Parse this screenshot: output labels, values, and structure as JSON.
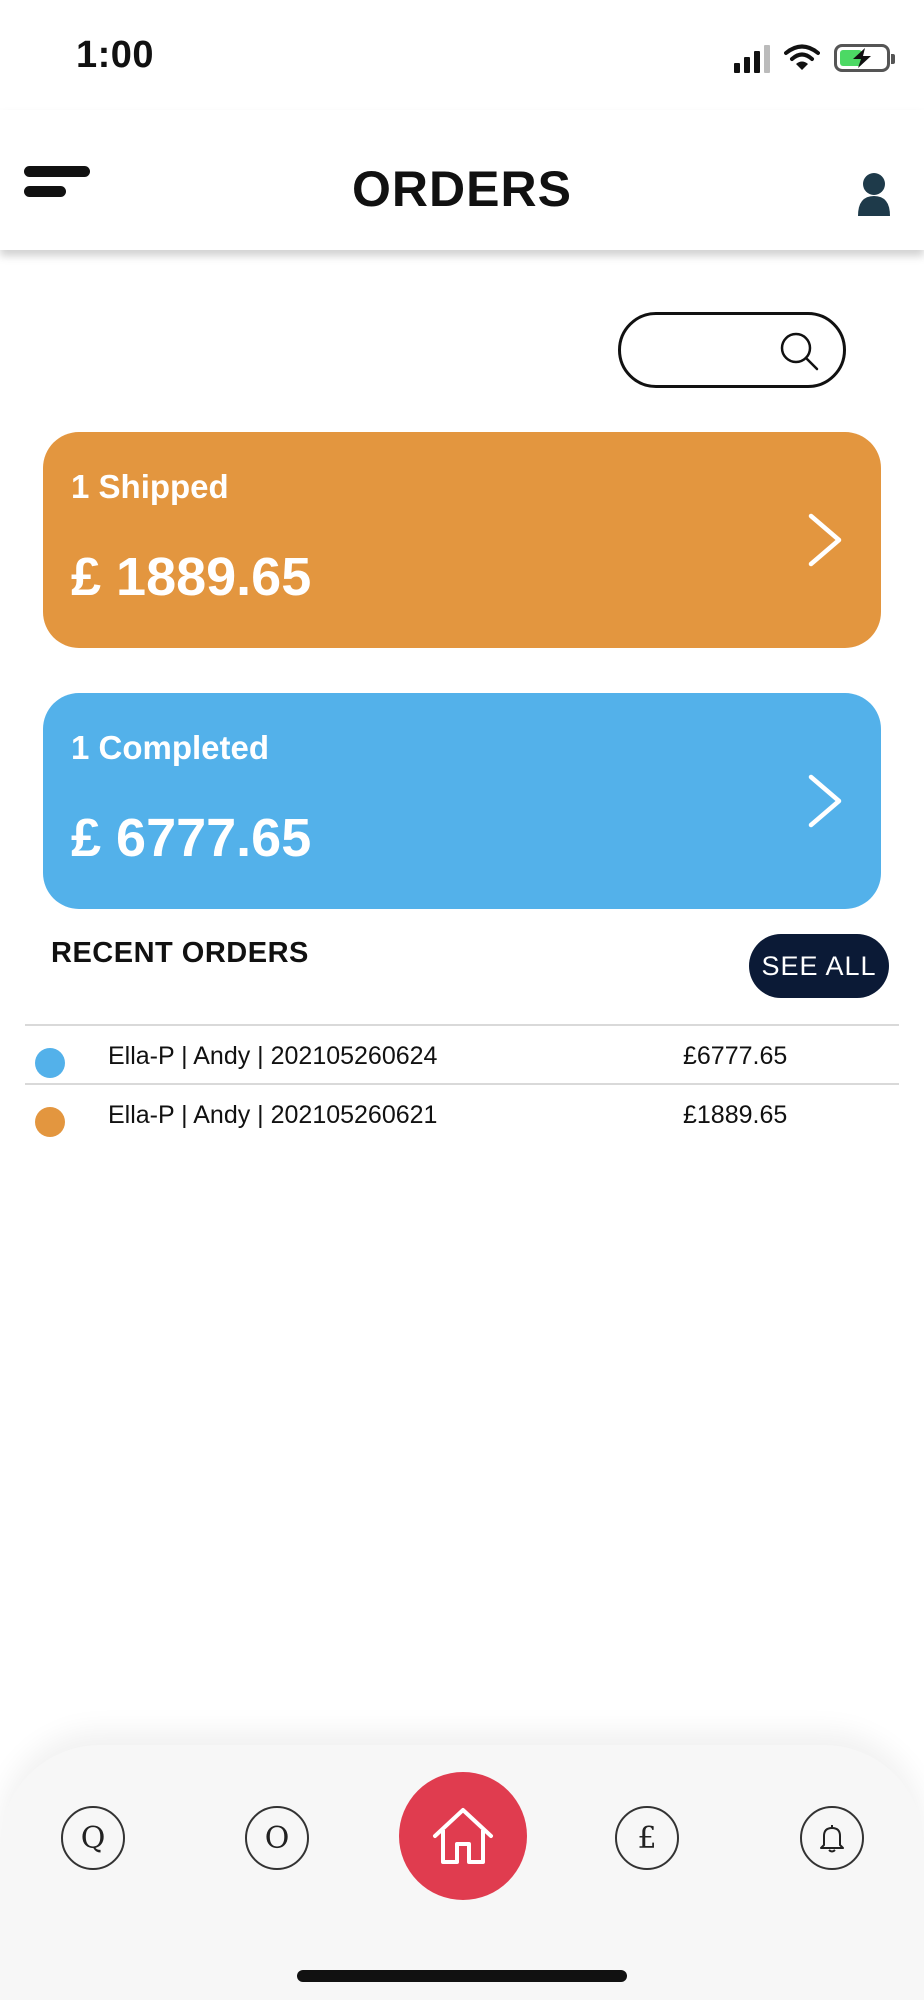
{
  "status_bar": {
    "time": "1:00",
    "icons": [
      "signal-icon",
      "wifi-icon",
      "battery-charging-icon"
    ]
  },
  "header": {
    "title": "ORDERS",
    "menu_icon": "menu-icon",
    "profile_icon": "user-icon"
  },
  "search": {
    "placeholder": "",
    "value": "",
    "icon": "search-icon"
  },
  "cards": [
    {
      "label": "1 Shipped",
      "amount": "£ 1889.65",
      "color": "#e3963f",
      "icon": "chevron-right-icon"
    },
    {
      "label": "1 Completed",
      "amount": "£ 6777.65",
      "color": "#53b1ea",
      "icon": "chevron-right-icon"
    }
  ],
  "recent": {
    "title": "RECENT ORDERS",
    "see_all_label": "SEE ALL",
    "orders": [
      {
        "text": "Ella-P | Andy | 202105260624",
        "amount": "£6777.65",
        "status_color": "#53b1ea"
      },
      {
        "text": "Ella-P | Andy | 202105260621",
        "amount": "£1889.65",
        "status_color": "#e3963f"
      }
    ]
  },
  "bottom_nav": {
    "items": [
      {
        "glyph": "Q",
        "icon": "quotes-icon"
      },
      {
        "glyph": "O",
        "icon": "orders-icon"
      },
      {
        "glyph": "",
        "icon": "home-icon",
        "active": true
      },
      {
        "glyph": "£",
        "icon": "pound-icon"
      },
      {
        "glyph": "",
        "icon": "bell-icon"
      }
    ],
    "active_color": "#e03c4f"
  },
  "colors": {
    "shipped": "#e3963f",
    "completed": "#53b1ea",
    "see_all_bg": "#0b1a36",
    "home_accent": "#e03c4f"
  }
}
